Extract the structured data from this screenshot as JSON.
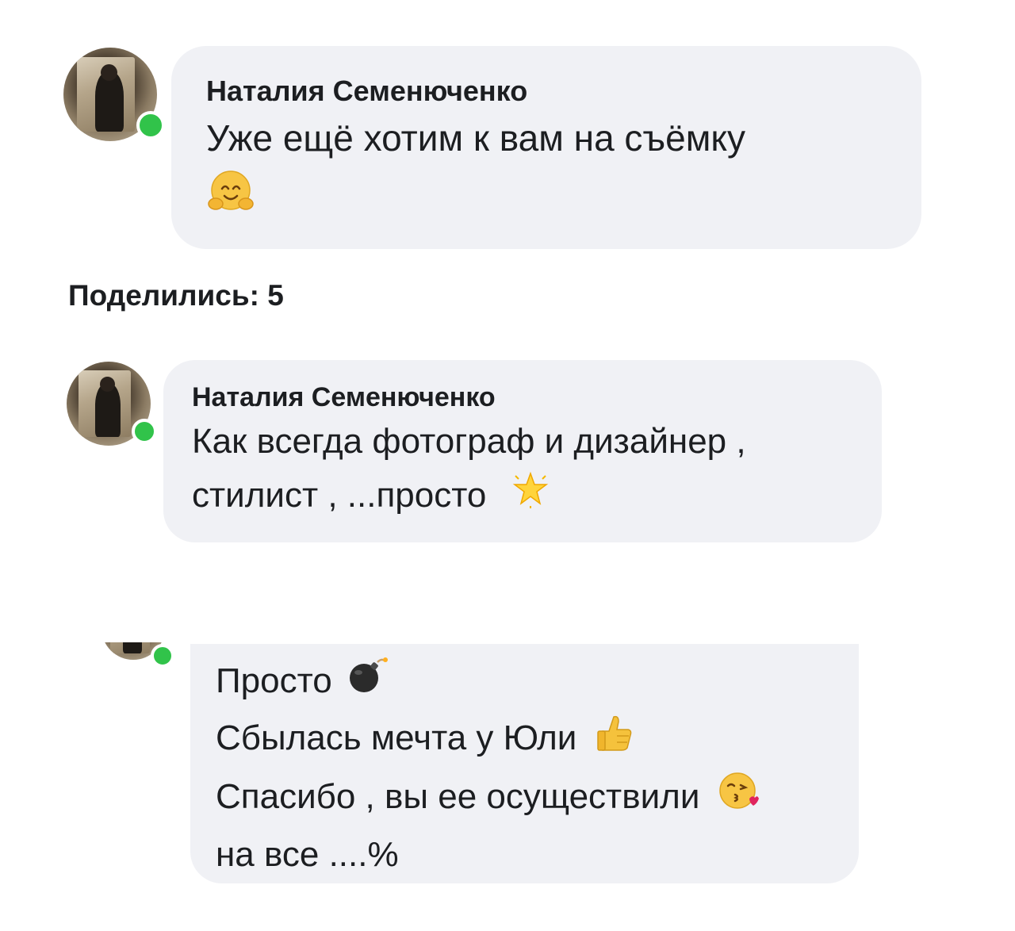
{
  "comments": [
    {
      "author": "Наталия Семенюченко",
      "line1": "Уже ещё хотим к вам на съёмку",
      "emoji": "hugging-face"
    },
    {
      "author": "Наталия Семенюченко",
      "line1": "Как всегда фотограф и дизайнер ,",
      "line2": "стилист , ...просто",
      "emoji": "star"
    },
    {
      "line1": "Просто",
      "line1_emoji": "bomb",
      "line2": "Сбылась мечта у Юли",
      "line2_emoji": "thumbs-up",
      "line3": "Спасибо , вы ее осуществили",
      "line3_emoji": "kissing-face",
      "line4": "на все ....%"
    }
  ],
  "shared": {
    "label": "Поделились: 5"
  },
  "colors": {
    "bubble": "#f0f1f5",
    "online": "#31c34a",
    "text": "#1c1e21"
  }
}
